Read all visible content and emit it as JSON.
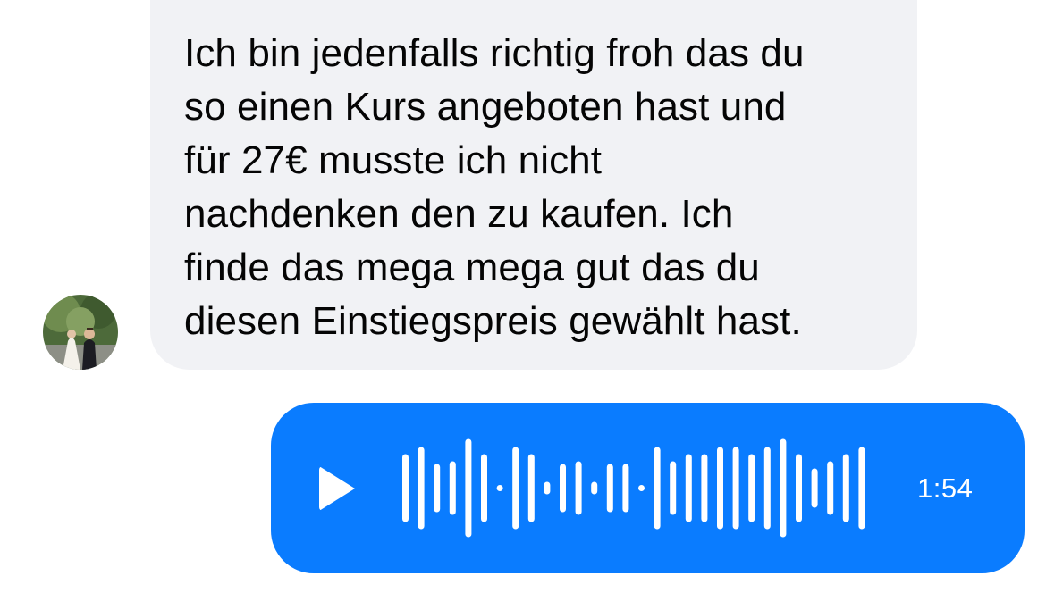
{
  "received_message": {
    "text": "Ich bin jedenfalls richtig froh das du\nso einen Kurs angeboten hast und\nfür 27€ musste ich nicht\nnachdenken den zu kaufen. Ich\nfinde das mega mega gut das du\ndiesen Einstiegspreis gewählt hast.",
    "bubble_color": "#f1f2f5",
    "text_color": "#050505"
  },
  "sender_avatar": {
    "icon": "profile-photo-couple"
  },
  "voice_message": {
    "duration": "1:54",
    "play_icon": "play-icon",
    "bubble_color": "#0a7cff",
    "foreground_color": "#ffffff"
  }
}
